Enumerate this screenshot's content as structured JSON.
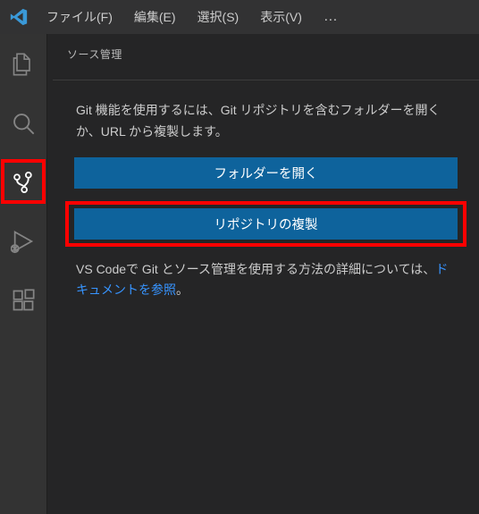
{
  "menubar": {
    "items": [
      "ファイル(F)",
      "編集(E)",
      "選択(S)",
      "表示(V)"
    ],
    "overflow": "…"
  },
  "activity": {
    "items": [
      {
        "name": "explorer-icon"
      },
      {
        "name": "search-icon"
      },
      {
        "name": "source-control-icon",
        "active": true
      },
      {
        "name": "run-debug-icon"
      },
      {
        "name": "extensions-icon"
      }
    ]
  },
  "panel": {
    "title": "ソース管理",
    "info": "Git 機能を使用するには、Git リポジトリを含むフォルダーを開くか、URL から複製します。",
    "open_folder": "フォルダーを開く",
    "clone_repo": "リポジトリの複製",
    "doc_prefix": "VS Codeで Git とソース管理を使用する方法の詳細については、",
    "doc_link": "ドキュメントを参照",
    "doc_suffix": "。"
  },
  "colors": {
    "accent": "#0e639c",
    "highlight": "#ff0000",
    "link": "#3794ff"
  }
}
